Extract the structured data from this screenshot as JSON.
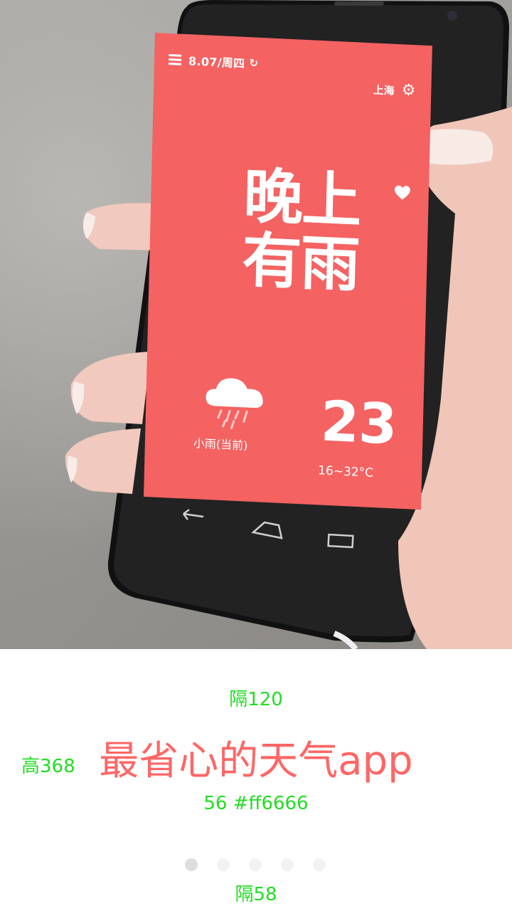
{
  "app_screen": {
    "status_date": "8.07/周四",
    "city": "上海",
    "headline_line1": "晚上",
    "headline_line2": "有雨",
    "current_condition": "小雨(当前)",
    "temperature": "23",
    "temperature_range": "16~32°C",
    "icons": [
      "menu-icon",
      "refresh-icon",
      "gear-icon",
      "heart-icon",
      "rain-cloud-icon",
      "back-icon",
      "home-icon",
      "recent-apps-icon"
    ],
    "screen_color": "#f46262"
  },
  "annotations": {
    "gap_top": "隔120",
    "height": "高368",
    "font_spec": "56  #ff6666",
    "gap_bottom": "隔58",
    "color": "#22dd22"
  },
  "tagline": {
    "text": "最省心的天气app",
    "color": "#ff6666"
  },
  "pagination": {
    "total_pages": 5,
    "current_page": 1
  }
}
